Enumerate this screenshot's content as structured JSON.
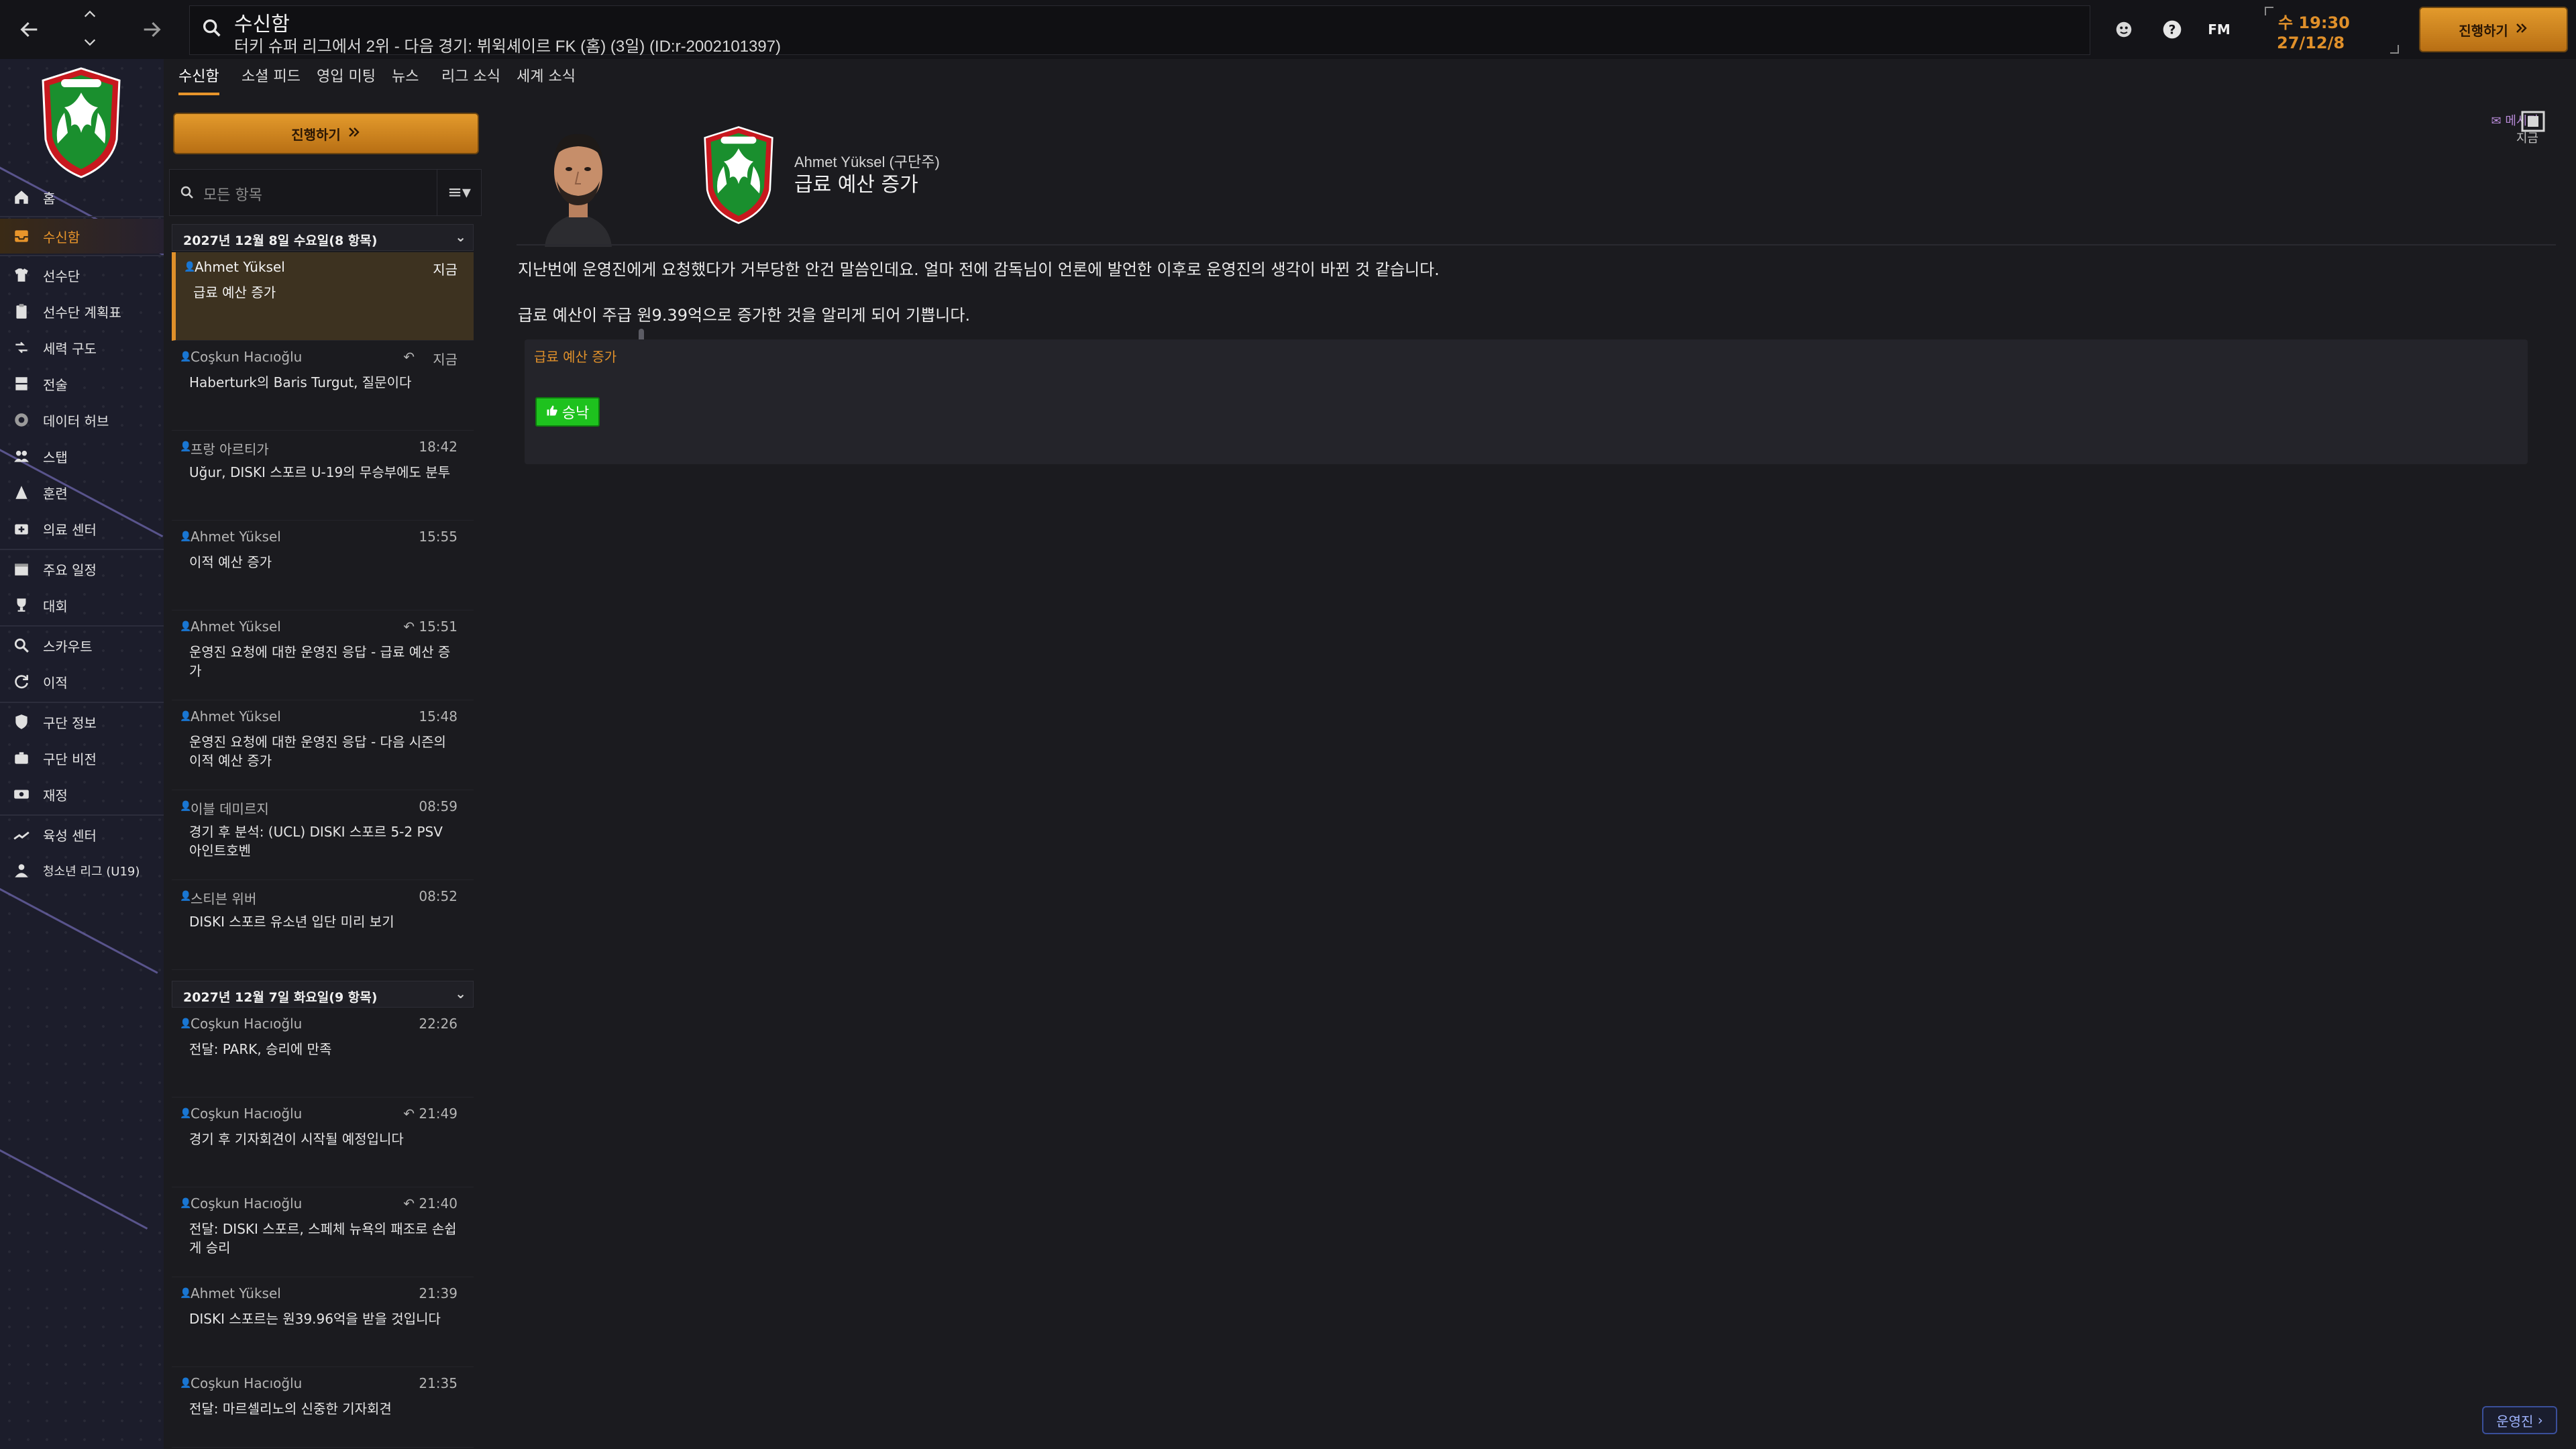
{
  "topbar": {
    "title": "수신함",
    "subtitle": "터키 슈퍼 리그에서 2위 - 다음 경기: 뷔윅셰이르 FK (홈) (3일) (ID:r-2002101397)",
    "fm_label": "FM",
    "clock_day_time": "수 19:30",
    "clock_date": "27/12/8",
    "continue_label": "진행하기"
  },
  "sidebar": {
    "items": [
      {
        "label": "홈",
        "icon": "home-icon"
      },
      {
        "label": "수신함",
        "icon": "inbox-icon"
      },
      {
        "label": "선수단",
        "icon": "shirt-icon"
      },
      {
        "label": "선수단 계획표",
        "icon": "clipboard-icon"
      },
      {
        "label": "세력 구도",
        "icon": "dynamics-icon"
      },
      {
        "label": "전술",
        "icon": "tactics-icon"
      },
      {
        "label": "데이터 허브",
        "icon": "data-icon"
      },
      {
        "label": "스탭",
        "icon": "staff-icon"
      },
      {
        "label": "훈련",
        "icon": "training-icon"
      },
      {
        "label": "의료 센터",
        "icon": "medical-icon"
      },
      {
        "label": "주요 일정",
        "icon": "calendar-icon"
      },
      {
        "label": "대회",
        "icon": "trophy-icon"
      },
      {
        "label": "스카우트",
        "icon": "scout-icon"
      },
      {
        "label": "이적",
        "icon": "transfer-icon"
      },
      {
        "label": "구단 정보",
        "icon": "shield-icon"
      },
      {
        "label": "구단 비전",
        "icon": "vision-icon"
      },
      {
        "label": "재정",
        "icon": "finance-icon"
      },
      {
        "label": "육성 센터",
        "icon": "development-icon"
      },
      {
        "label": "청소년 리그 (U19)",
        "icon": "youth-icon"
      }
    ]
  },
  "tabs": [
    "수신함",
    "소셜 피드",
    "영입 미팅",
    "뉴스",
    "리그 소식",
    "세계 소식"
  ],
  "inbox": {
    "continue_label": "진행하기",
    "search_placeholder": "모든 항목",
    "groups": [
      {
        "header": "2027년 12월 8일 수요일(8 항목)"
      },
      {
        "header": "2027년 12월 7일 화요일(9 항목)"
      }
    ],
    "messages": [
      {
        "sender": "Ahmet Yüksel",
        "time": "지금",
        "subject": "급료 예산 증가"
      },
      {
        "sender": "Coşkun Hacıoğlu",
        "time": "지금",
        "subject": "Haberturk의 Baris Turgut, 질문이다"
      },
      {
        "sender": "프랑 아르티가",
        "time": "18:42",
        "subject": "Uğur, DISKI 스포르 U-19의 무승부에도 분투"
      },
      {
        "sender": "Ahmet Yüksel",
        "time": "15:55",
        "subject": "이적 예산 증가"
      },
      {
        "sender": "Ahmet Yüksel",
        "time": "15:51",
        "subject": "운영진 요청에 대한 운영진 응답 - 급료 예산 증가"
      },
      {
        "sender": "Ahmet Yüksel",
        "time": "15:48",
        "subject": "운영진 요청에 대한 운영진 응답 - 다음 시즌의 이적 예산 증가"
      },
      {
        "sender": "이블 데미르지",
        "time": "08:59",
        "subject": "경기 후 분석: (UCL) DISKI 스포르 5-2 PSV 아인트호벤"
      },
      {
        "sender": "스티븐 위버",
        "time": "08:52",
        "subject": "DISKI 스포르 유소년 입단 미리 보기"
      },
      {
        "sender": "Coşkun Hacıoğlu",
        "time": "22:26",
        "subject": "전달: PARK, 승리에 만족"
      },
      {
        "sender": "Coşkun Hacıoğlu",
        "time": "21:49",
        "subject": "경기 후 기자회견이 시작될 예정입니다"
      },
      {
        "sender": "Coşkun Hacıoğlu",
        "time": "21:40",
        "subject": "전달: DISKI 스포르, 스페체 뉴욕의 패조로 손쉽게 승리"
      },
      {
        "sender": "Ahmet Yüksel",
        "time": "21:39",
        "subject": "DISKI 스포르는 원39.96억을 받을 것입니다"
      },
      {
        "sender": "Coşkun Hacıoğlu",
        "time": "21:35",
        "subject": "전달: 마르셀리노의 신중한 기자회견"
      }
    ]
  },
  "message": {
    "from": "Ahmet Yüksel (구단주)",
    "title": "급료 예산 증가",
    "badge": "메시지",
    "when": "지금",
    "body": [
      "지난번에 운영진에게 요청했다가 거부당한 안건 말씀인데요. 얼마 전에 감독님이 언론에 발언한 이후로 운영진의 생각이 바뀐 것 같습니다.",
      "급료 예산이 주급 원9.39억으로 증가한 것을 알리게 되어 기쁩니다."
    ],
    "action_label": "급료 예산 증가",
    "accept_label": "승낙"
  },
  "footer": {
    "board_label": "운영진"
  },
  "colors": {
    "accent": "#e8952b",
    "accept": "#1ec21e",
    "sidebar_bg": "#1c1d2b"
  }
}
